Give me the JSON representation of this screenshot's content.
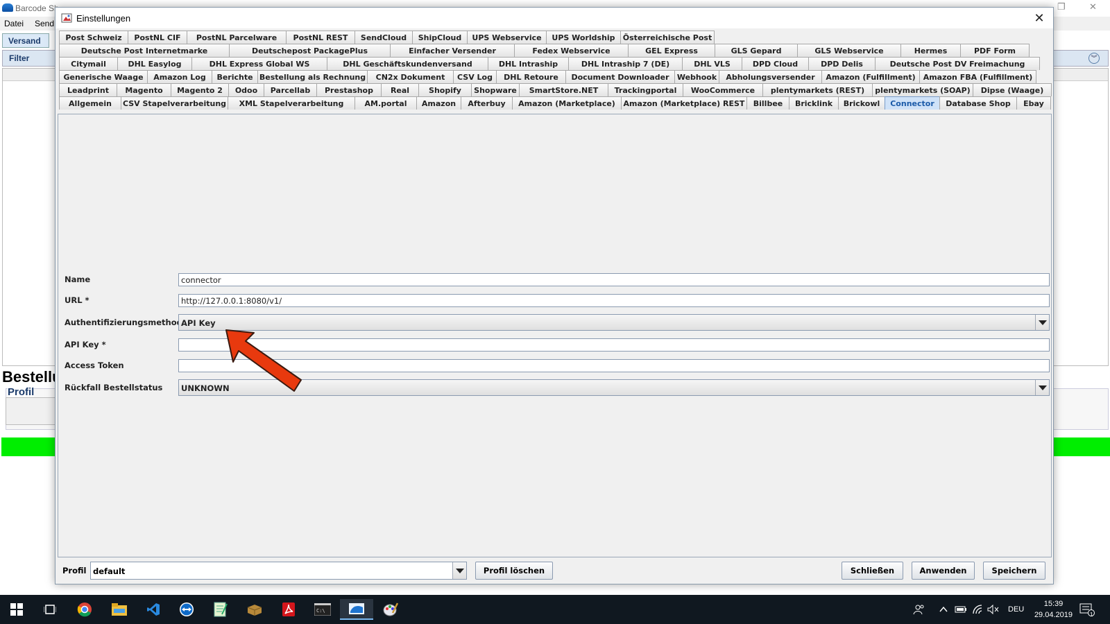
{
  "bg_app": {
    "title": "Barcode Sh",
    "menu": [
      "Datei",
      "Send"
    ],
    "tab": "Versand",
    "filter_label": "Filter",
    "section_title": "Bestellu",
    "profil_label": "Profil"
  },
  "dialog": {
    "title": "Einstellungen",
    "tab_rows": [
      [
        "Post Schweiz",
        "PostNL CIF",
        "PostNL Parcelware",
        "PostNL REST",
        "SendCloud",
        "ShipCloud",
        "UPS Webservice",
        "UPS Worldship",
        "Österreichische Post"
      ],
      [
        "Deutsche Post Internetmarke",
        "Deutschepost PackagePlus",
        "Einfacher Versender",
        "Fedex Webservice",
        "GEL Express",
        "GLS Gepard",
        "GLS Webservice",
        "Hermes",
        "PDF Form"
      ],
      [
        "Citymail",
        "DHL Easylog",
        "DHL Express Global WS",
        "DHL Geschäftskundenversand",
        "DHL Intraship",
        "DHL Intraship 7 (DE)",
        "DHL VLS",
        "DPD Cloud",
        "DPD Delis",
        "Deutsche Post DV Freimachung"
      ],
      [
        "Generische Waage",
        "Amazon Log",
        "Berichte",
        "Bestellung als Rechnung",
        "CN2x Dokument",
        "CSV Log",
        "DHL Retoure",
        "Document Downloader",
        "Webhook",
        "Abholungsversender",
        "Amazon (Fulfillment)",
        "Amazon FBA (Fulfillment)"
      ],
      [
        "Leadprint",
        "Magento",
        "Magento 2",
        "Odoo",
        "Parcellab",
        "Prestashop",
        "Real",
        "Shopify",
        "Shopware",
        "SmartStore.NET",
        "Trackingportal",
        "WooCommerce",
        "plentymarkets (REST)",
        "plentymarkets (SOAP)",
        "Dipse (Waage)"
      ],
      [
        "Allgemein",
        "CSV Stapelverarbeitung",
        "XML Stapelverarbeitung",
        "AM.portal",
        "Amazon",
        "Afterbuy",
        "Amazon (Marketplace)",
        "Amazon (Marketplace) REST",
        "Billbee",
        "Bricklink",
        "Brickowl",
        "Connector",
        "Database Shop",
        "Ebay"
      ]
    ],
    "active_tab": "Connector",
    "form": {
      "name_label": "Name",
      "name_value": "connector",
      "url_label": "URL *",
      "url_value": "http://127.0.0.1:8080/v1/",
      "auth_label": "Authentifizierungsmethode",
      "auth_value": "API Key",
      "apikey_label": "API Key *",
      "apikey_value": "",
      "token_label": "Access Token",
      "token_value": "",
      "fallback_label": "Rückfall Bestellstatus",
      "fallback_value": "UNKNOWN"
    },
    "bottom": {
      "profil_label": "Profil",
      "profil_value": "default",
      "delete_button": "Profil löschen",
      "close_button": "Schließen",
      "apply_button": "Anwenden",
      "save_button": "Speichern"
    }
  },
  "taskbar": {
    "language": "DEU",
    "time": "15:39",
    "date": "29.04.2019",
    "notification_count": "1",
    "apps": [
      "start-icon",
      "task-view-icon",
      "chrome-icon",
      "file-explorer-icon",
      "vscode-icon",
      "teamviewer-icon",
      "notepad-icon",
      "package-icon",
      "acrobat-icon",
      "terminal-icon",
      "barcode-shipping-icon",
      "paint-icon"
    ]
  },
  "colors": {
    "highlight_arrow": "#e8390e",
    "active_tab": "#cfe2f8",
    "status_bar_green": "#00ee00"
  }
}
